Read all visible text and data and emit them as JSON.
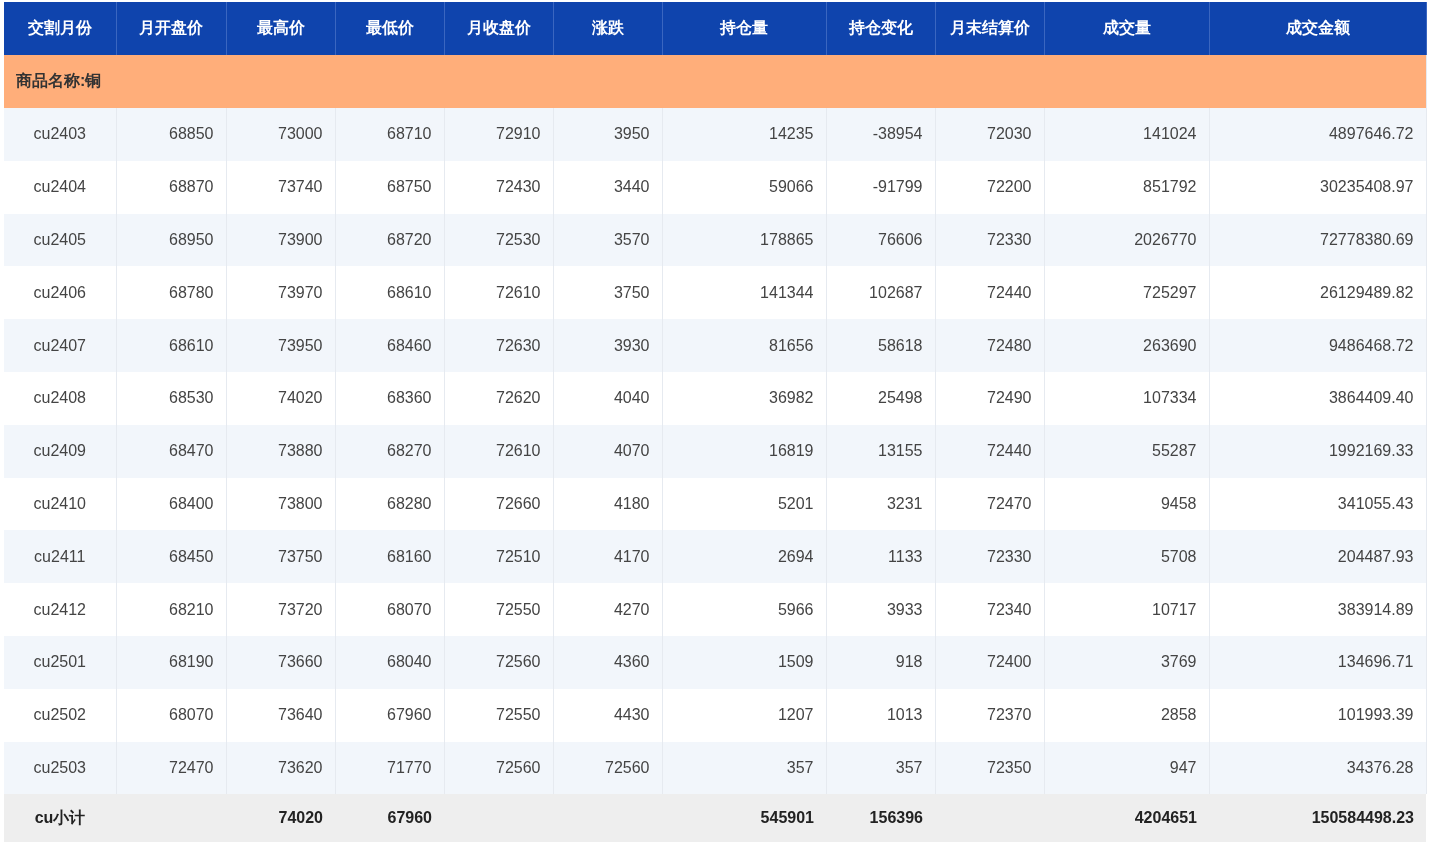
{
  "table": {
    "columns": [
      "交割月份",
      "月开盘价",
      "最高价",
      "最低价",
      "月收盘价",
      "涨跌",
      "持仓量",
      "持仓变化",
      "月末结算价",
      "成交量",
      "成交金额"
    ],
    "group": "商品名称:铜",
    "rows": [
      [
        "cu2403",
        "68850",
        "73000",
        "68710",
        "72910",
        "3950",
        "14235",
        "-38954",
        "72030",
        "141024",
        "4897646.72"
      ],
      [
        "cu2404",
        "68870",
        "73740",
        "68750",
        "72430",
        "3440",
        "59066",
        "-91799",
        "72200",
        "851792",
        "30235408.97"
      ],
      [
        "cu2405",
        "68950",
        "73900",
        "68720",
        "72530",
        "3570",
        "178865",
        "76606",
        "72330",
        "2026770",
        "72778380.69"
      ],
      [
        "cu2406",
        "68780",
        "73970",
        "68610",
        "72610",
        "3750",
        "141344",
        "102687",
        "72440",
        "725297",
        "26129489.82"
      ],
      [
        "cu2407",
        "68610",
        "73950",
        "68460",
        "72630",
        "3930",
        "81656",
        "58618",
        "72480",
        "263690",
        "9486468.72"
      ],
      [
        "cu2408",
        "68530",
        "74020",
        "68360",
        "72620",
        "4040",
        "36982",
        "25498",
        "72490",
        "107334",
        "3864409.40"
      ],
      [
        "cu2409",
        "68470",
        "73880",
        "68270",
        "72610",
        "4070",
        "16819",
        "13155",
        "72440",
        "55287",
        "1992169.33"
      ],
      [
        "cu2410",
        "68400",
        "73800",
        "68280",
        "72660",
        "4180",
        "5201",
        "3231",
        "72470",
        "9458",
        "341055.43"
      ],
      [
        "cu2411",
        "68450",
        "73750",
        "68160",
        "72510",
        "4170",
        "2694",
        "1133",
        "72330",
        "5708",
        "204487.93"
      ],
      [
        "cu2412",
        "68210",
        "73720",
        "68070",
        "72550",
        "4270",
        "5966",
        "3933",
        "72340",
        "10717",
        "383914.89"
      ],
      [
        "cu2501",
        "68190",
        "73660",
        "68040",
        "72560",
        "4360",
        "1509",
        "918",
        "72400",
        "3769",
        "134696.71"
      ],
      [
        "cu2502",
        "68070",
        "73640",
        "67960",
        "72550",
        "4430",
        "1207",
        "1013",
        "72370",
        "2858",
        "101993.39"
      ],
      [
        "cu2503",
        "72470",
        "73620",
        "71770",
        "72560",
        "72560",
        "357",
        "357",
        "72350",
        "947",
        "34376.28"
      ]
    ],
    "total": {
      "label": "cu小计",
      "high": "74020",
      "low": "67960",
      "open_interest": "545901",
      "oi_change": "156396",
      "volume": "4204651",
      "turnover": "150584498.23"
    }
  }
}
